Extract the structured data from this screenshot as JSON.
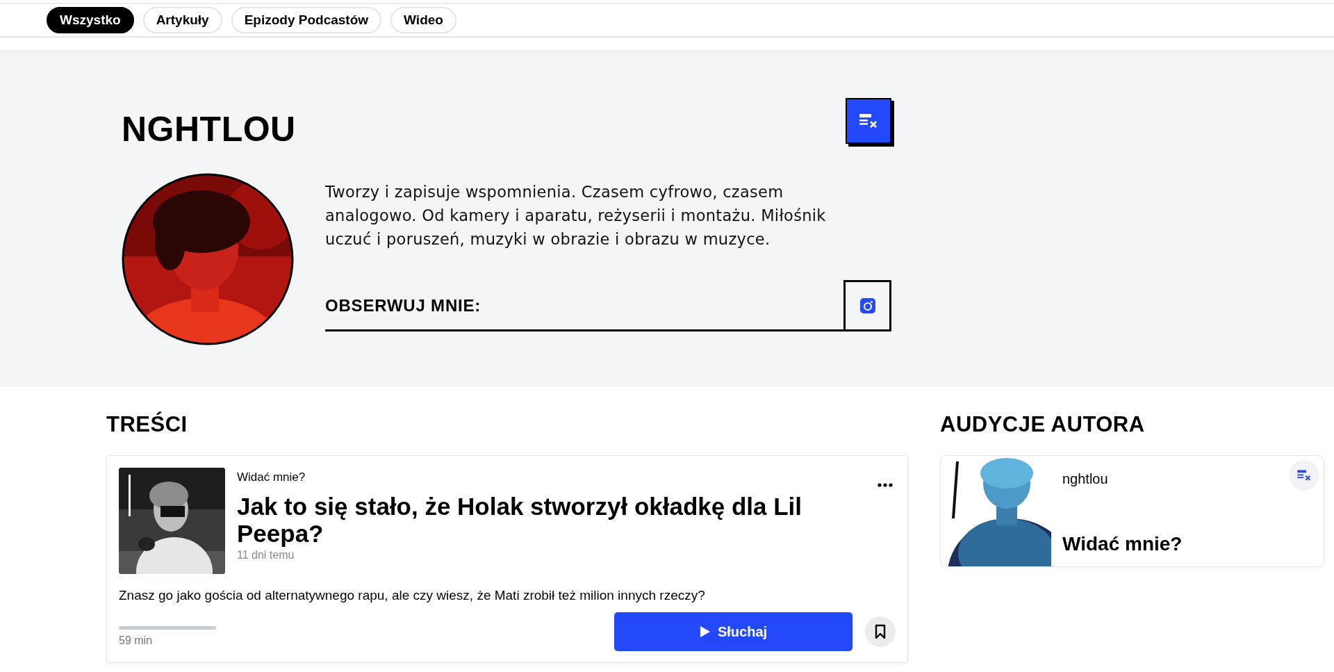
{
  "tabs": [
    {
      "label": "Wszystko",
      "selected": true
    },
    {
      "label": "Artykuły",
      "selected": false
    },
    {
      "label": "Epizody Podcastów",
      "selected": false
    },
    {
      "label": "Wideo",
      "selected": false
    }
  ],
  "profile": {
    "name": "NGHTLOU",
    "bio": "Tworzy i zapisuje wspomnienia. Czasem cyfrowo, czasem analogowo. Od kamery i aparatu, reżyserii i montażu. Miłośnik uczuć i poruszeń, muzyki w obrazie i obrazu w muzyce.",
    "follow_label": "OBSERWUJ MNIE:"
  },
  "contents": {
    "heading": "TREŚCI",
    "items": [
      {
        "series": "Widać mnie?",
        "title": "Jak to się stało, że Holak stworzył okładkę dla Lil Peepa?",
        "age": "11 dni temu",
        "description": "Znasz go jako gościa od alternatywnego rapu, ale czy wiesz, że Mati zrobił też milion innych rzeczy?",
        "level": 0,
        "duration": "59 min",
        "listen_label": "Słuchaj"
      }
    ]
  },
  "author_shows": {
    "heading": "AUDYCJE AUTORA",
    "items": [
      {
        "author": "nghtlou",
        "title": "Widać mnie?"
      }
    ]
  }
}
